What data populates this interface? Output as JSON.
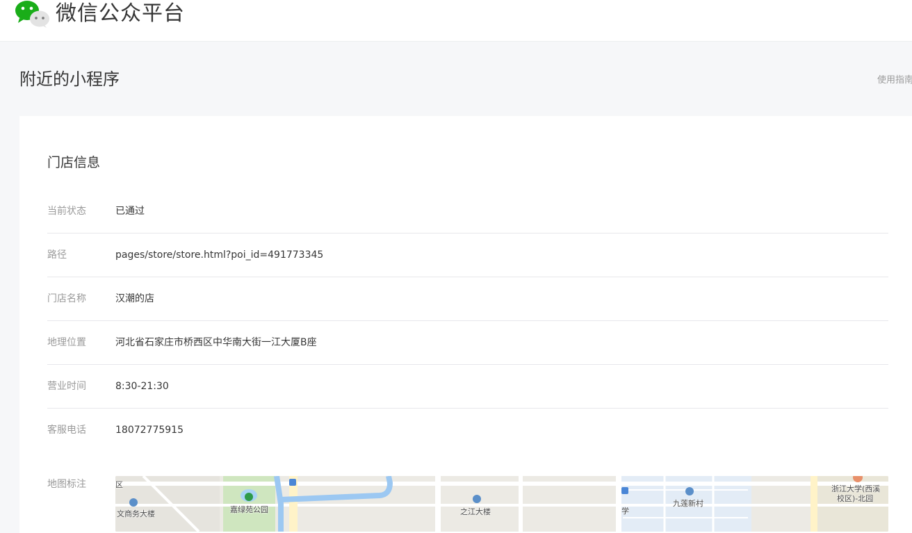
{
  "header": {
    "brand": "微信公众平台"
  },
  "page": {
    "title": "附近的小程序",
    "guide_link": "使用指南"
  },
  "store": {
    "section_title": "门店信息",
    "rows": [
      {
        "label": "当前状态",
        "value": "已通过"
      },
      {
        "label": "路径",
        "value": "pages/store/store.html?poi_id=491773345"
      },
      {
        "label": "门店名称",
        "value": "汉潮的店"
      },
      {
        "label": "地理位置",
        "value": "河北省石家庄市桥西区中华南大街一江大厦B座"
      },
      {
        "label": "营业时间",
        "value": "8:30-21:30"
      },
      {
        "label": "客服电话",
        "value": "18072775915"
      }
    ],
    "map_label": "地图标注",
    "map_places": {
      "p1": "嘉绿苑公园",
      "p2": "之江大楼",
      "p3": "九莲新村",
      "p4": "浙江大学(西溪",
      "p5": "校区)-北园",
      "p6": "文商务大楼",
      "p7": "区",
      "p8": "学"
    }
  },
  "colors": {
    "wechat_green": "#1aad19",
    "label_gray": "#9a9a9a",
    "divider": "#e7e7eb"
  }
}
